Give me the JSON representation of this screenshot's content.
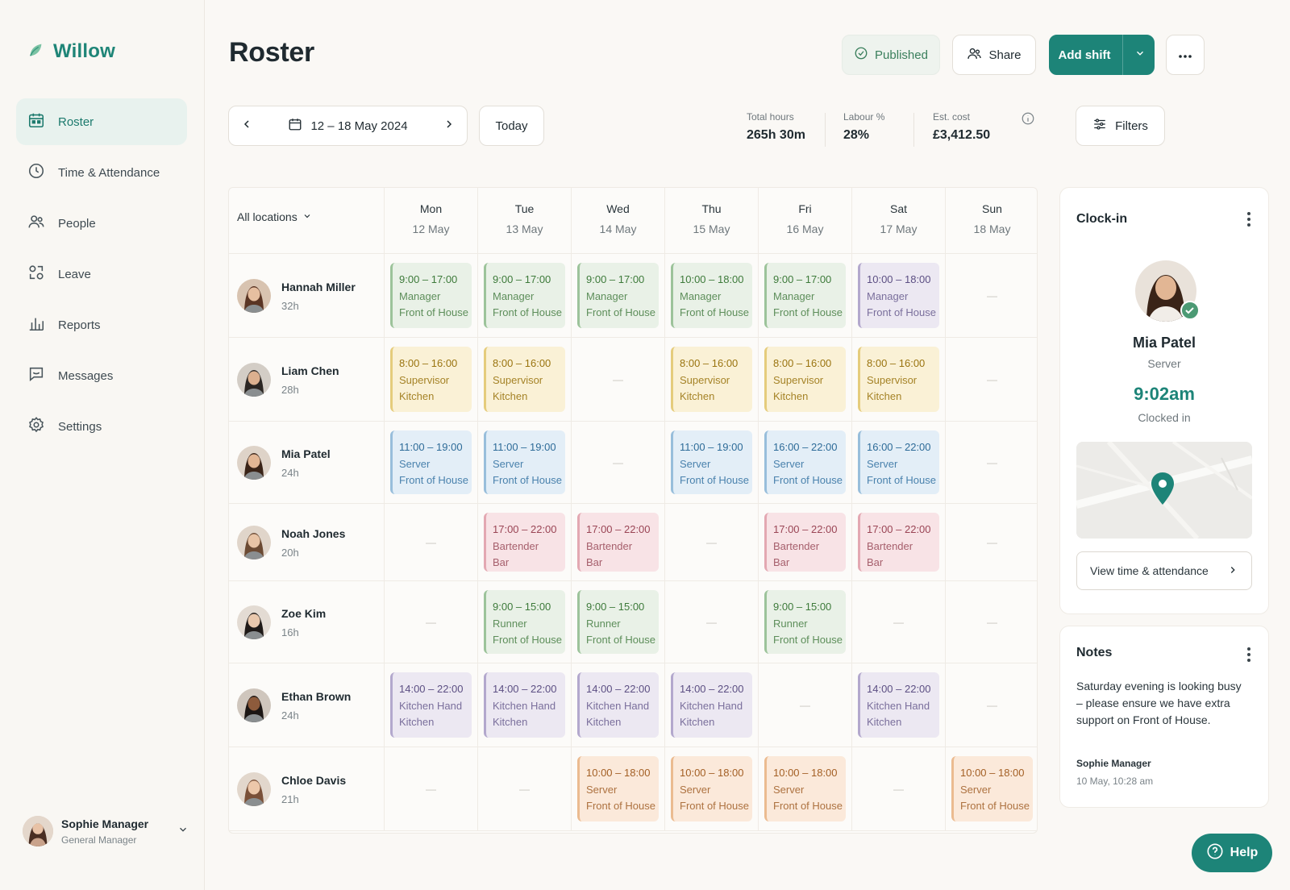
{
  "app": {
    "name": "Willow",
    "accent": "#1d8478"
  },
  "nav": [
    {
      "label": "Roster",
      "icon": "calendar-icon",
      "active": true
    },
    {
      "label": "Time & Attendance",
      "icon": "clock-icon"
    },
    {
      "label": "People",
      "icon": "people-icon"
    },
    {
      "label": "Leave",
      "icon": "leave-icon"
    },
    {
      "label": "Reports",
      "icon": "bar-chart-icon"
    },
    {
      "label": "Messages",
      "icon": "message-icon"
    },
    {
      "label": "Settings",
      "icon": "gear-icon"
    }
  ],
  "user": {
    "name": "Sophie Manager",
    "role": "General Manager"
  },
  "header": {
    "title": "Roster",
    "published_label": "Published",
    "share_label": "Share",
    "add_shift_label": "Add shift"
  },
  "week": {
    "range": "12 – 18 May 2024",
    "today_label": "Today"
  },
  "stats": [
    {
      "label": "Total hours",
      "value": "265h 30m"
    },
    {
      "label": "Labour %",
      "value": "28%"
    },
    {
      "label": "Est. cost",
      "value": "£3,412.50"
    }
  ],
  "filters_label": "Filters",
  "grid": {
    "location_label": "All locations",
    "days": [
      {
        "name": "Mon",
        "date": "12 May"
      },
      {
        "name": "Tue",
        "date": "13 May"
      },
      {
        "name": "Wed",
        "date": "14 May"
      },
      {
        "name": "Thu",
        "date": "15 May"
      },
      {
        "name": "Fri",
        "date": "16 May"
      },
      {
        "name": "Sat",
        "date": "17 May"
      },
      {
        "name": "Sun",
        "date": "18 May"
      }
    ],
    "empty_mark": "—",
    "employees": [
      {
        "name": "Hannah Miller",
        "hours": "32h",
        "shifts": [
          {
            "time": "9:00 – 17:00",
            "role": "Manager",
            "area": "Front of House",
            "color": "green"
          },
          {
            "time": "9:00 – 17:00",
            "role": "Manager",
            "area": "Front of House",
            "color": "green"
          },
          {
            "time": "9:00 – 17:00",
            "role": "Manager",
            "area": "Front of House",
            "color": "green"
          },
          {
            "time": "10:00 – 18:00",
            "role": "Manager",
            "area": "Front of House",
            "color": "green"
          },
          {
            "time": "9:00 – 17:00",
            "role": "Manager",
            "area": "Front of House",
            "color": "green"
          },
          {
            "time": "10:00 – 18:00",
            "role": "Manager",
            "area": "Front of House",
            "color": "purple"
          },
          null
        ]
      },
      {
        "name": "Liam Chen",
        "hours": "28h",
        "shifts": [
          {
            "time": "8:00 – 16:00",
            "role": "Supervisor",
            "area": "Kitchen",
            "color": "yellow"
          },
          {
            "time": "8:00 – 16:00",
            "role": "Supervisor",
            "area": "Kitchen",
            "color": "yellow"
          },
          null,
          {
            "time": "8:00 – 16:00",
            "role": "Supervisor",
            "area": "Kitchen",
            "color": "yellow"
          },
          {
            "time": "8:00 – 16:00",
            "role": "Supervisor",
            "area": "Kitchen",
            "color": "yellow"
          },
          {
            "time": "8:00 – 16:00",
            "role": "Supervisor",
            "area": "Kitchen",
            "color": "yellow"
          },
          null
        ]
      },
      {
        "name": "Mia Patel",
        "hours": "24h",
        "shifts": [
          {
            "time": "11:00 – 19:00",
            "role": "Server",
            "area": "Front of House",
            "color": "blue"
          },
          {
            "time": "11:00 – 19:00",
            "role": "Server",
            "area": "Front of House",
            "color": "blue"
          },
          null,
          {
            "time": "11:00 – 19:00",
            "role": "Server",
            "area": "Front of House",
            "color": "blue"
          },
          {
            "time": "16:00 – 22:00",
            "role": "Server",
            "area": "Front of House",
            "color": "blue"
          },
          {
            "time": "16:00 – 22:00",
            "role": "Server",
            "area": "Front of House",
            "color": "blue"
          },
          null
        ]
      },
      {
        "name": "Noah Jones",
        "hours": "20h",
        "shifts": [
          null,
          {
            "time": "17:00 – 22:00",
            "role": "Bartender",
            "area": "Bar",
            "color": "pink"
          },
          {
            "time": "17:00 – 22:00",
            "role": "Bartender",
            "area": "Bar",
            "color": "pink"
          },
          null,
          {
            "time": "17:00 – 22:00",
            "role": "Bartender",
            "area": "Bar",
            "color": "pink"
          },
          {
            "time": "17:00 – 22:00",
            "role": "Bartender",
            "area": "Bar",
            "color": "pink"
          },
          null
        ]
      },
      {
        "name": "Zoe Kim",
        "hours": "16h",
        "shifts": [
          null,
          {
            "time": "9:00 – 15:00",
            "role": "Runner",
            "area": "Front of House",
            "color": "green"
          },
          {
            "time": "9:00 – 15:00",
            "role": "Runner",
            "area": "Front of House",
            "color": "green"
          },
          null,
          {
            "time": "9:00 – 15:00",
            "role": "Runner",
            "area": "Front of House",
            "color": "green"
          },
          null,
          null
        ]
      },
      {
        "name": "Ethan Brown",
        "hours": "24h",
        "shifts": [
          {
            "time": "14:00 – 22:00",
            "role": "Kitchen Hand",
            "area": "Kitchen",
            "color": "purple"
          },
          {
            "time": "14:00 – 22:00",
            "role": "Kitchen Hand",
            "area": "Kitchen",
            "color": "purple"
          },
          {
            "time": "14:00 – 22:00",
            "role": "Kitchen Hand",
            "area": "Kitchen",
            "color": "purple"
          },
          {
            "time": "14:00 – 22:00",
            "role": "Kitchen Hand",
            "area": "Kitchen",
            "color": "purple"
          },
          null,
          {
            "time": "14:00 – 22:00",
            "role": "Kitchen Hand",
            "area": "Kitchen",
            "color": "purple"
          },
          null
        ]
      },
      {
        "name": "Chloe Davis",
        "hours": "21h",
        "shifts": [
          null,
          null,
          {
            "time": "10:00 – 18:00",
            "role": "Server",
            "area": "Front of House",
            "color": "orange"
          },
          {
            "time": "10:00 – 18:00",
            "role": "Server",
            "area": "Front of House",
            "color": "orange"
          },
          {
            "time": "10:00 – 18:00",
            "role": "Server",
            "area": "Front of House",
            "color": "orange"
          },
          null,
          {
            "time": "10:00 – 18:00",
            "role": "Server",
            "area": "Front of House",
            "color": "orange"
          }
        ]
      }
    ]
  },
  "clock_in": {
    "title": "Clock-in",
    "name": "Mia Patel",
    "role": "Server",
    "time": "9:02am",
    "status": "Clocked in",
    "view_label": "View time & attendance"
  },
  "notes": {
    "title": "Notes",
    "text": "Saturday evening is looking busy – please ensure we have extra support on Front of House.",
    "author": "Sophie Manager",
    "date": "10 May, 10:28 am"
  },
  "help_label": "Help"
}
